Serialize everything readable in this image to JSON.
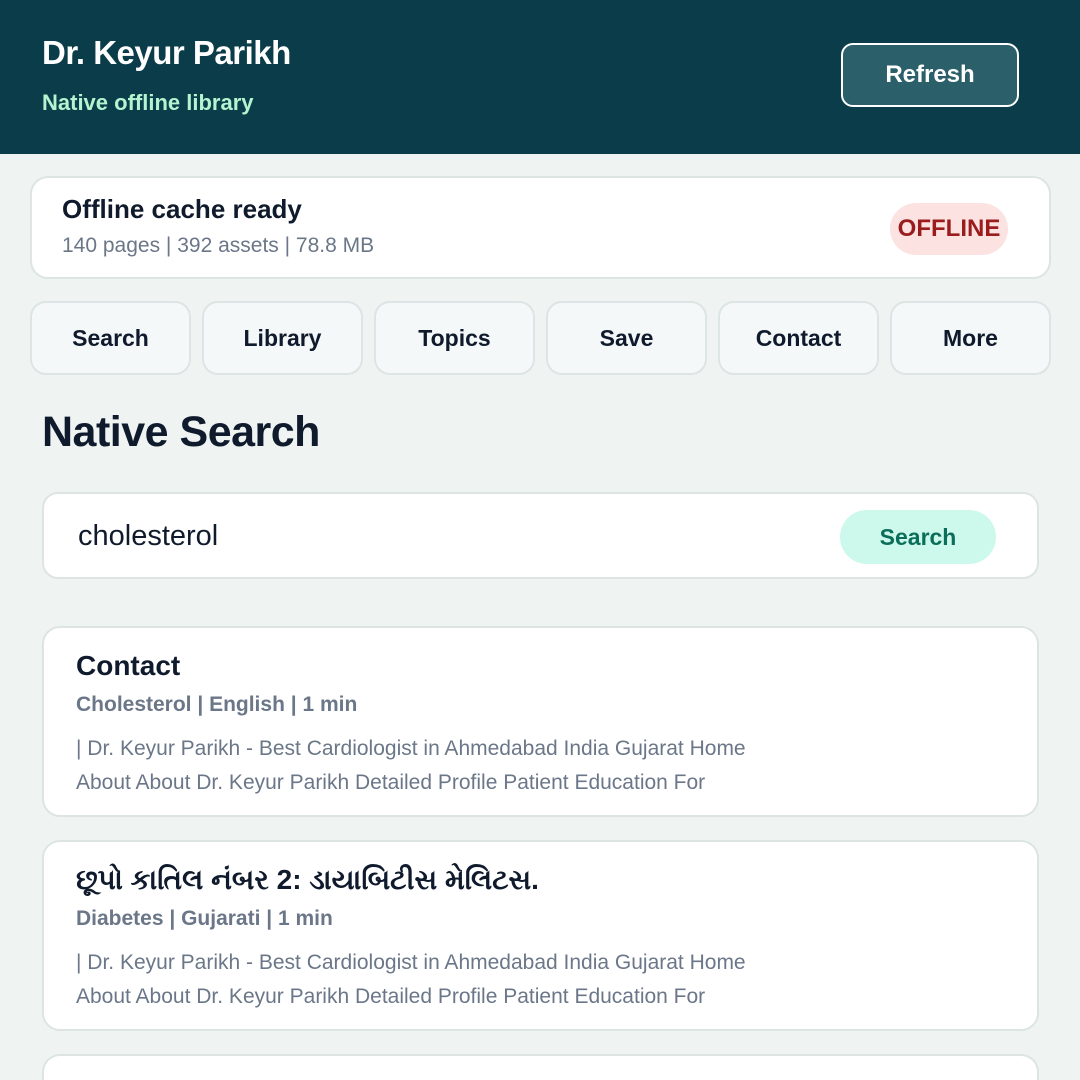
{
  "header": {
    "title": "Dr. Keyur Parikh",
    "subtitle": "Native offline library",
    "refresh_label": "Refresh"
  },
  "status": {
    "title": "Offline cache ready",
    "meta": "140 pages | 392 assets | 78.8 MB",
    "badge": "OFFLINE"
  },
  "nav": {
    "items": [
      {
        "label": "Search"
      },
      {
        "label": "Library"
      },
      {
        "label": "Topics"
      },
      {
        "label": "Save"
      },
      {
        "label": "Contact"
      },
      {
        "label": "More"
      }
    ]
  },
  "main": {
    "section_title": "Native Search",
    "search": {
      "value": "cholesterol",
      "button_label": "Search"
    },
    "results": [
      {
        "title": "Contact",
        "meta": "Cholesterol | English | 1 min",
        "snippet": "| Dr. Keyur Parikh - Best Cardiologist in Ahmedabad India Gujarat Home About About Dr. Keyur Parikh Detailed Profile Patient Education For"
      },
      {
        "title": "છૂપો કાતિલ નંબર 2: ડાયાબિટીસ મેલિટસ.",
        "meta": "Diabetes | Gujarati | 1 min",
        "snippet": "| Dr. Keyur Parikh - Best Cardiologist in Ahmedabad India Gujarat Home About About Dr. Keyur Parikh Detailed Profile Patient Education For"
      }
    ]
  }
}
